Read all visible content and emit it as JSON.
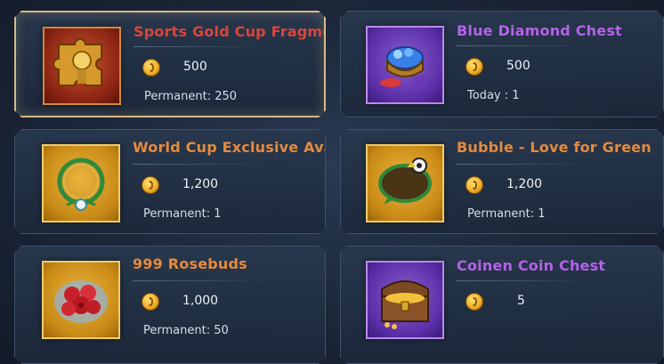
{
  "colors": {
    "title_red": "#d8463a",
    "title_purple": "#b462e8",
    "title_orange": "#e68a3c",
    "selected_border": "#d6b98a"
  },
  "items": [
    {
      "title": "Sports Gold Cup Fragments",
      "price": "500",
      "limit": "Permanent: 250",
      "icon": "gold-cup-fragment-icon",
      "rarity": "red",
      "selected": true
    },
    {
      "title": "Blue Diamond Chest",
      "price": "500",
      "limit": "Today : 1",
      "icon": "diamond-chest-icon",
      "rarity": "purple",
      "selected": false
    },
    {
      "title": "World Cup Exclusive Avatar Frame",
      "price": "1,200",
      "limit": "Permanent: 1",
      "icon": "avatar-frame-icon",
      "rarity": "gold",
      "selected": false
    },
    {
      "title": "Bubble - Love for Green",
      "price": "1,200",
      "limit": "Permanent: 1",
      "icon": "chat-bubble-icon",
      "rarity": "gold",
      "selected": false
    },
    {
      "title": "999 Rosebuds",
      "price": "1,000",
      "limit": "Permanent: 50",
      "icon": "rose-bouquet-icon",
      "rarity": "gold",
      "selected": false
    },
    {
      "title": "Coinen Coin Chest",
      "price": "5",
      "limit": "",
      "icon": "treasure-chest-icon",
      "rarity": "purple",
      "selected": false
    }
  ]
}
